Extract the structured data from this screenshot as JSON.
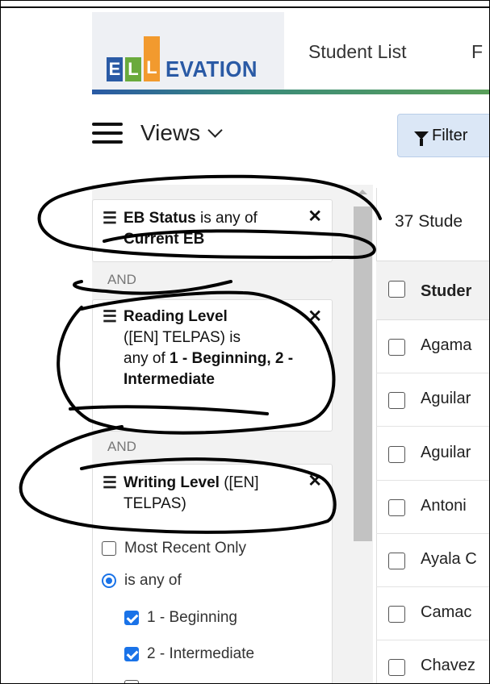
{
  "header": {
    "logo_text": "EVATION",
    "logo_letters": [
      "E",
      "L",
      "L"
    ],
    "nav": [
      "Student List",
      "F"
    ]
  },
  "toolbar": {
    "views_label": "Views",
    "filter_label": "Filter"
  },
  "filters": [
    {
      "field": "EB Status",
      "op": "is any of",
      "value": "Current EB"
    },
    {
      "field": "Reading Level",
      "qualifier": "([EN] TELPAS) is",
      "op": "any of",
      "values": "1 - Beginning, 2 -",
      "values2": "Intermediate"
    },
    {
      "field": "Writing Level",
      "qualifier": "([EN]",
      "qualifier2": "TELPAS)"
    }
  ],
  "and_label": "AND",
  "writing_options": {
    "most_recent": "Most Recent Only",
    "is_any_of": "is any of",
    "levels": [
      "1 - Beginning",
      "2 - Intermediate"
    ]
  },
  "students": {
    "count": "37 Stude",
    "header": "Studer",
    "rows": [
      "Agama",
      "Aguilar",
      "Aguilar",
      "Antoni",
      "Ayala C",
      "Camac",
      "Chavez"
    ]
  },
  "colors": {
    "brand_blue": "#2a5aa5",
    "brand_green": "#6aaa3c",
    "brand_orange": "#f29a2e",
    "checkbox_blue": "#1a73e8"
  }
}
